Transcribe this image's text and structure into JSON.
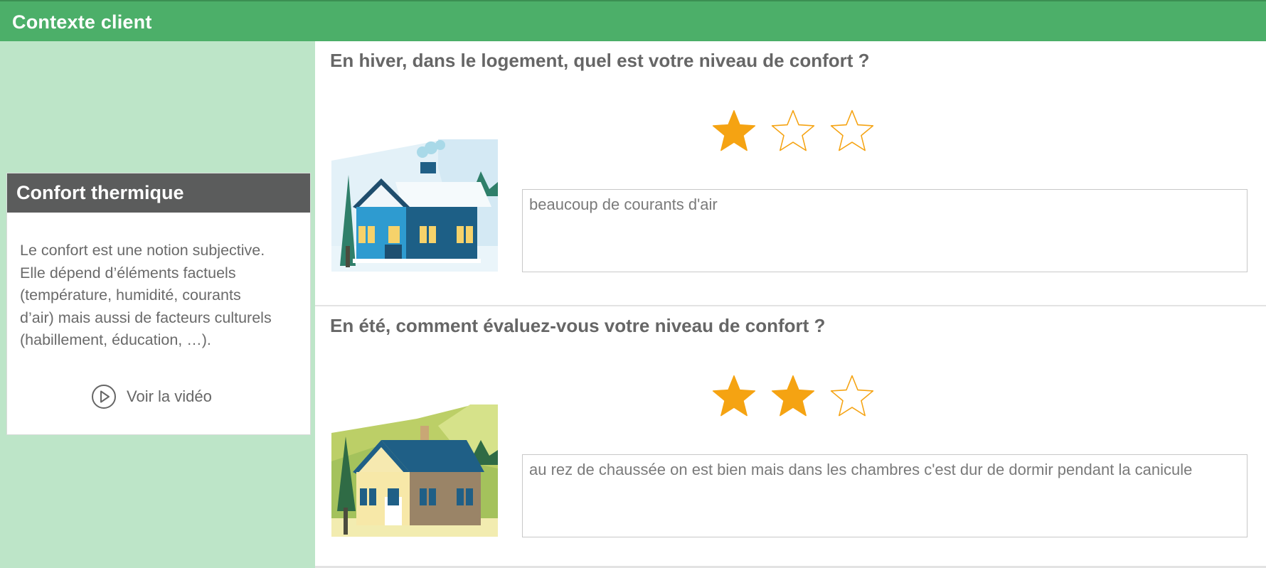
{
  "header": {
    "title": "Contexte client"
  },
  "sidebar": {
    "card_title": "Confort thermique",
    "lines": [
      "Le confort est une notion subjective.",
      "Elle dépend d’éléments factuels",
      "(température, humidité, courants",
      "d’air) mais aussi de facteurs culturels",
      "(habillement, éducation, …)."
    ],
    "video_label": "Voir la vidéo",
    "video_icon": "play-circle-icon"
  },
  "questions": [
    {
      "text": "En hiver, dans le logement, quel est votre niveau de confort ?",
      "rating": 1,
      "max_rating": 3,
      "comment": "beaucoup de courants d'air",
      "illustration": "winter-house-illustration"
    },
    {
      "text": "En été, comment évaluez-vous votre niveau de confort ?",
      "rating": 2,
      "max_rating": 3,
      "comment": "au rez de chaussée on est bien mais dans les chambres c'est dur de dormir pendant la canicule",
      "illustration": "summer-house-illustration"
    }
  ],
  "colors": {
    "header_bg": "#4caf69",
    "sidebar_bg": "#bde5c8",
    "card_header_bg": "#5b5c5c",
    "star": "#f5a312"
  }
}
